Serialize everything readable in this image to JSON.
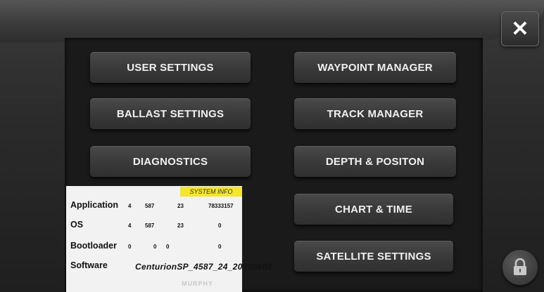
{
  "header": {
    "close_icon": "close-icon"
  },
  "menu": {
    "user_settings": "USER SETTINGS",
    "ballast_settings": "BALLAST SETTINGS",
    "diagnostics": "DIAGNOSTICS",
    "waypoint_manager": "WAYPOINT MANAGER",
    "track_manager": "TRACK MANAGER",
    "depth_position": "DEPTH & POSITON",
    "chart_time": "CHART & TIME",
    "satellite_settings": "SATELLITE SETTINGS"
  },
  "system_info": {
    "badge": "SYSTEM INFO",
    "rows": [
      {
        "label": "Application",
        "v1": "4",
        "v2": "587",
        "v3": "23",
        "v4": "78333157"
      },
      {
        "label": "OS",
        "v1": "4",
        "v2": "587",
        "v3": "23",
        "v4": "0"
      },
      {
        "label": "Bootloader",
        "v1": "0",
        "v2": "0",
        "v3": "0",
        "v4": "0"
      }
    ],
    "software_label": "Software",
    "software_version": "CenturionSP_4587_24_20200602",
    "watermark": "MURPHY"
  },
  "footer": {
    "lock_icon": "lock-icon"
  },
  "colors": {
    "background": "#2b2b2b",
    "button": "#3a3a3a",
    "badge": "#f5e62a",
    "info_panel": "#f2f2f2"
  }
}
